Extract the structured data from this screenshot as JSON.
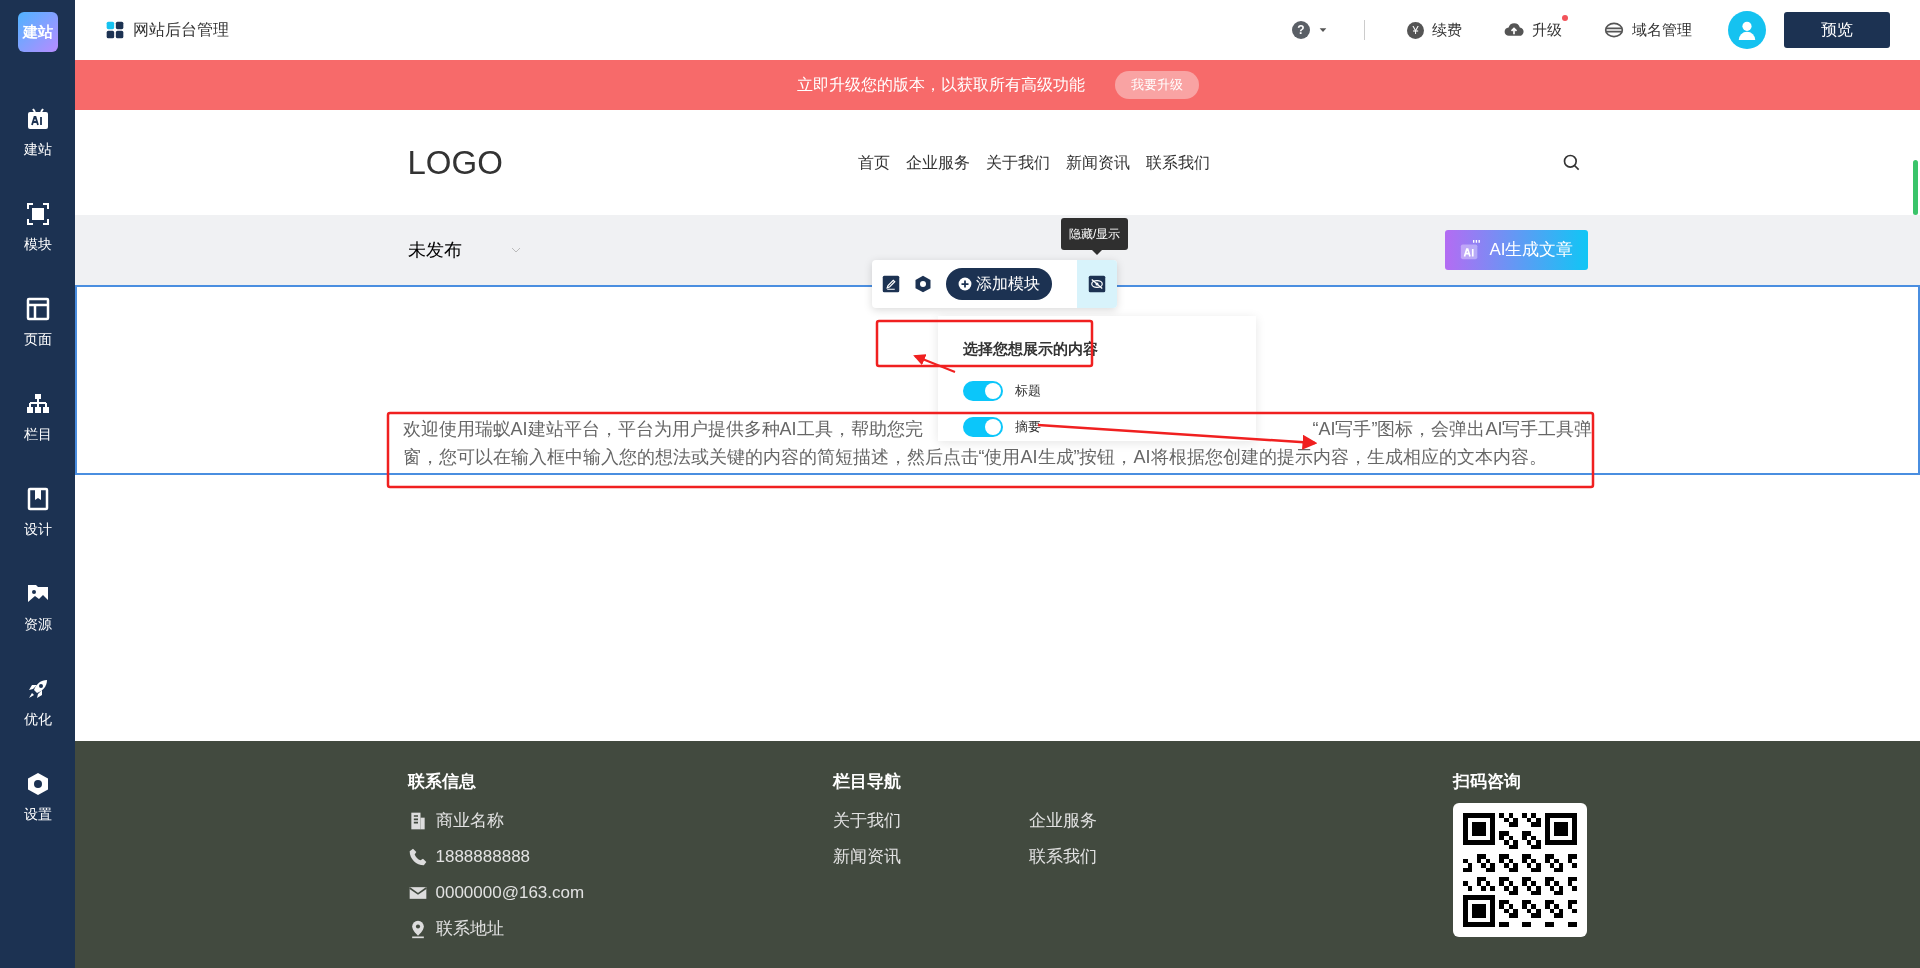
{
  "sidebar": {
    "logo": "建站",
    "items": [
      {
        "label": "建站",
        "kind": "ai"
      },
      {
        "label": "模块",
        "kind": "frame"
      },
      {
        "label": "页面",
        "kind": "layout"
      },
      {
        "label": "栏目",
        "kind": "tree"
      },
      {
        "label": "设计",
        "kind": "book"
      },
      {
        "label": "资源",
        "kind": "image"
      },
      {
        "label": "优化",
        "kind": "rocket"
      },
      {
        "label": "设置",
        "kind": "hex"
      }
    ]
  },
  "topbar": {
    "title": "网站后台管理",
    "help": "?",
    "actions": [
      {
        "label": "续费",
        "kind": "yen",
        "symbol": "¥",
        "notification": false
      },
      {
        "label": "升级",
        "kind": "upload",
        "notification": true
      },
      {
        "label": "域名管理",
        "kind": "domain",
        "notification": false
      }
    ],
    "preview_button": "预览"
  },
  "banner": {
    "text": "立即升级您的版本，以获取所有高级功能",
    "button": "我要升级"
  },
  "site_header": {
    "logo": "LOGO",
    "nav": [
      "首页",
      "企业服务",
      "关于我们",
      "新闻资讯",
      "联系我们"
    ]
  },
  "module_bar": {
    "status": "未发布",
    "ai_button": "AI生成文章"
  },
  "toolbar": {
    "tooltip": "隐藏/显示",
    "add_button": "添加模块"
  },
  "popup": {
    "title": "选择您想展示的内容",
    "options": [
      {
        "label": "标题",
        "on": true
      },
      {
        "label": "摘要",
        "on": true
      }
    ]
  },
  "paragraph": {
    "line_1_start": "欢迎使用瑞蚁AI建站平台，平台为用户提供多种AI工具，帮助您完",
    "line_1_end": "“AI写手”图标，会弹出AI写手工具弹",
    "line_2": "窗，您可以在输入框中输入您的想法或关键的内容的简短描述，然后点击“使用AI生成”按钮，AI将根据您创建的提示内容，生成相应的文本内容。"
  },
  "footer": {
    "contact": {
      "title": "联系信息",
      "items": [
        {
          "kind": "building",
          "text": "商业名称"
        },
        {
          "kind": "phone",
          "text": "1888888888"
        },
        {
          "kind": "mail",
          "text": "0000000@163.com"
        },
        {
          "kind": "pin",
          "text": "联系地址"
        }
      ]
    },
    "nav": {
      "title": "栏目导航",
      "links": [
        "关于我们",
        "企业服务",
        "新闻资讯",
        "联系我们"
      ]
    },
    "qr": {
      "title": "扫码咨询"
    }
  }
}
